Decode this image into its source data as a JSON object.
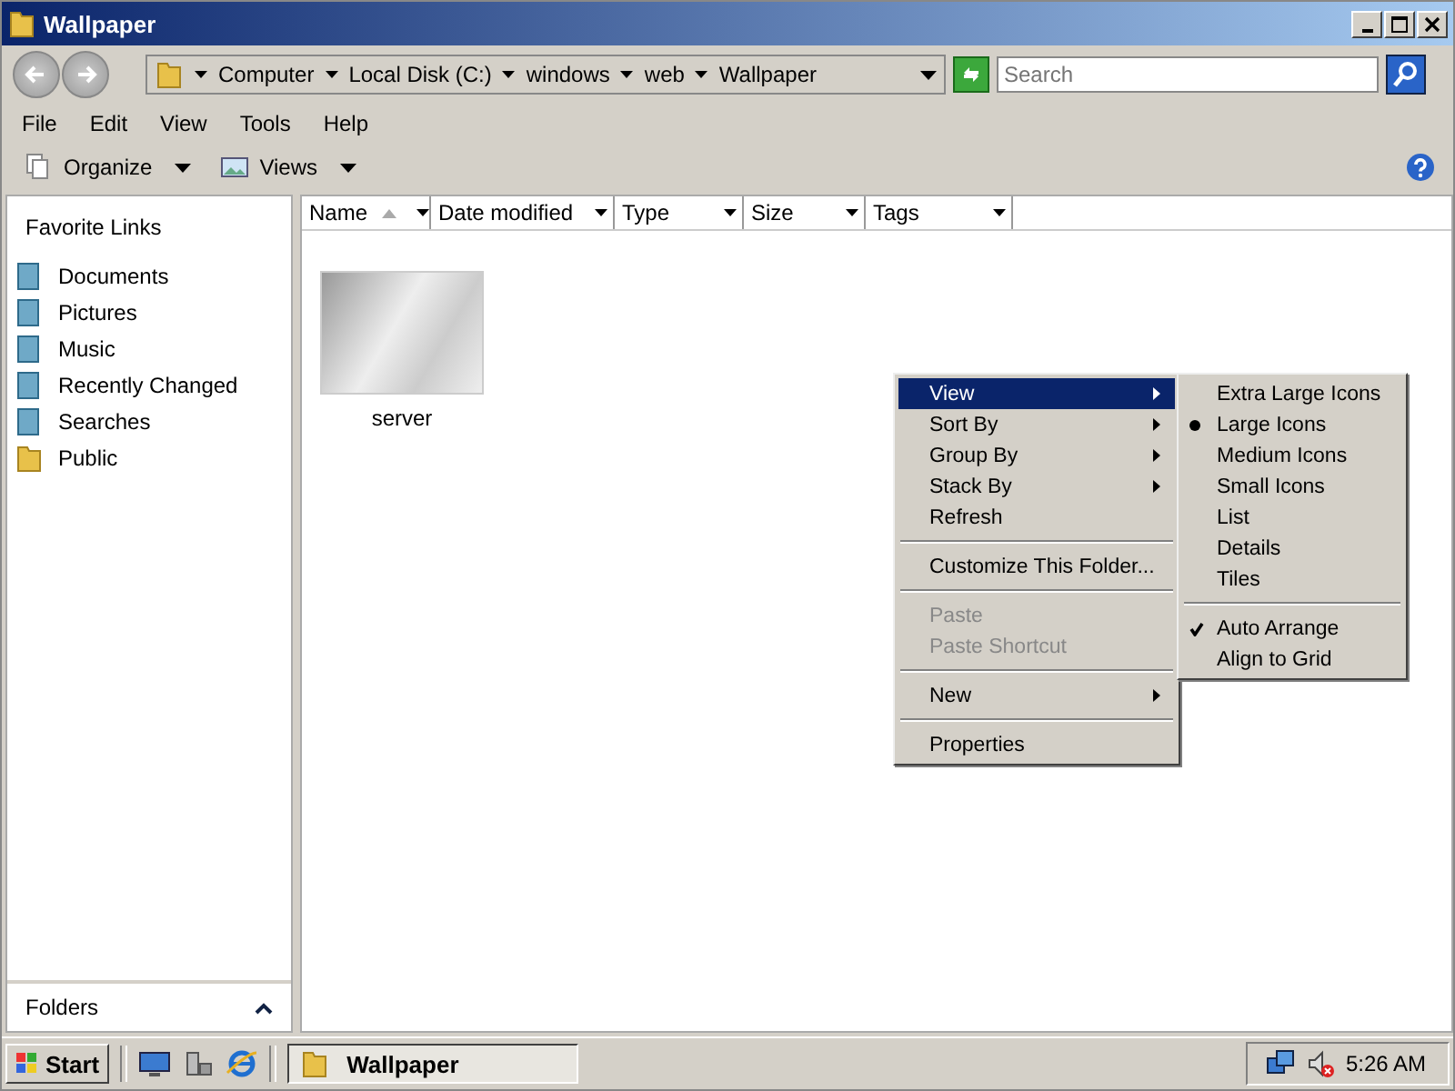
{
  "window": {
    "title": "Wallpaper"
  },
  "address": {
    "segments": [
      "Computer",
      "Local Disk (C:)",
      "windows",
      "web",
      "Wallpaper"
    ]
  },
  "search": {
    "placeholder": "Search"
  },
  "menu_bar": [
    "File",
    "Edit",
    "View",
    "Tools",
    "Help"
  ],
  "toolbar": [
    "Organize",
    "Views"
  ],
  "sidebar": {
    "heading": "Favorite Links",
    "items": [
      "Documents",
      "Pictures",
      "Music",
      "Recently Changed",
      "Searches",
      "Public"
    ],
    "folders_label": "Folders"
  },
  "columns": [
    {
      "label": "Name",
      "sorted": true
    },
    {
      "label": "Date modified",
      "sorted": false
    },
    {
      "label": "Type",
      "sorted": false
    },
    {
      "label": "Size",
      "sorted": false
    },
    {
      "label": "Tags",
      "sorted": false
    }
  ],
  "files": [
    {
      "name": "server"
    }
  ],
  "context_menu": {
    "groups": [
      [
        {
          "label": "View",
          "submenu": true,
          "selected": true,
          "disabled": false
        },
        {
          "label": "Sort By",
          "submenu": true,
          "selected": false,
          "disabled": false
        },
        {
          "label": "Group By",
          "submenu": true,
          "selected": false,
          "disabled": false
        },
        {
          "label": "Stack By",
          "submenu": true,
          "selected": false,
          "disabled": false
        },
        {
          "label": "Refresh",
          "submenu": false,
          "selected": false,
          "disabled": false
        }
      ],
      [
        {
          "label": "Customize This Folder...",
          "submenu": false,
          "selected": false,
          "disabled": false
        }
      ],
      [
        {
          "label": "Paste",
          "submenu": false,
          "selected": false,
          "disabled": true
        },
        {
          "label": "Paste Shortcut",
          "submenu": false,
          "selected": false,
          "disabled": true
        }
      ],
      [
        {
          "label": "New",
          "submenu": true,
          "selected": false,
          "disabled": false
        }
      ],
      [
        {
          "label": "Properties",
          "submenu": false,
          "selected": false,
          "disabled": false
        }
      ]
    ]
  },
  "submenu": {
    "groups": [
      [
        {
          "label": "Extra Large Icons",
          "kind": "radio",
          "checked": false
        },
        {
          "label": "Large Icons",
          "kind": "radio",
          "checked": true
        },
        {
          "label": "Medium Icons",
          "kind": "radio",
          "checked": false
        },
        {
          "label": "Small Icons",
          "kind": "radio",
          "checked": false
        },
        {
          "label": "List",
          "kind": "radio",
          "checked": false
        },
        {
          "label": "Details",
          "kind": "radio",
          "checked": false
        },
        {
          "label": "Tiles",
          "kind": "radio",
          "checked": false
        }
      ],
      [
        {
          "label": "Auto Arrange",
          "kind": "check",
          "checked": true
        },
        {
          "label": "Align to Grid",
          "kind": "check",
          "checked": false
        }
      ]
    ]
  },
  "taskbar": {
    "start": "Start",
    "tasks": [
      {
        "label": "Wallpaper",
        "selected": true
      }
    ],
    "clock": "5:26 AM"
  }
}
